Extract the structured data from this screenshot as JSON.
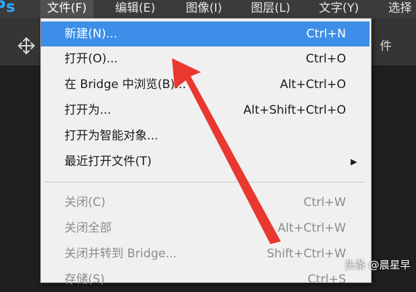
{
  "app": {
    "logo_text": "Ps"
  },
  "menubar": {
    "items": [
      {
        "label": "文件(F)",
        "active": true
      },
      {
        "label": "编辑(E)"
      },
      {
        "label": "图像(I)"
      },
      {
        "label": "图层(L)"
      },
      {
        "label": "文字(Y)"
      },
      {
        "label": "选择"
      }
    ]
  },
  "options_bar": {
    "right_text": "件"
  },
  "file_menu": {
    "items": [
      {
        "label": "新建(N)...",
        "shortcut": "Ctrl+N",
        "state": "selected"
      },
      {
        "label": "打开(O)...",
        "shortcut": "Ctrl+O"
      },
      {
        "label": "在 Bridge 中浏览(B)...",
        "shortcut": "Alt+Ctrl+O"
      },
      {
        "label": "打开为...",
        "shortcut": "Alt+Shift+Ctrl+O"
      },
      {
        "label": "打开为智能对象...",
        "shortcut": ""
      },
      {
        "label": "最近打开文件(T)",
        "shortcut": "",
        "submenu": true
      },
      {
        "label": "关闭(C)",
        "shortcut": "Ctrl+W",
        "state": "disabled"
      },
      {
        "label": "关闭全部",
        "shortcut": "Alt+Ctrl+W",
        "state": "disabled"
      },
      {
        "label": "关闭并转到 Bridge...",
        "shortcut": "Shift+Ctrl+W",
        "state": "disabled"
      },
      {
        "label": "存储(S)",
        "shortcut": "Ctrl+S",
        "state": "disabled"
      }
    ]
  },
  "watermark": {
    "text": "头条 @晨星早"
  },
  "colors": {
    "selection": "#3c8ee8",
    "annotation_arrow": "#e8382f",
    "ps_blue": "#31a8ff"
  }
}
